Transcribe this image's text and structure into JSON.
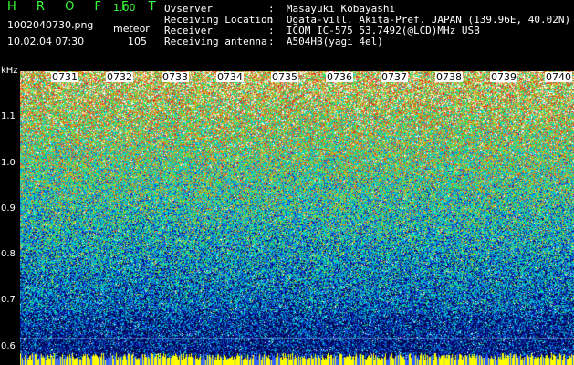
{
  "header": {
    "app_title": "H R O F F T",
    "app_version": "1.00",
    "file_name": "1002040730.png",
    "date_time": "10.02.04 07:30",
    "mode_label": "meteor",
    "mode_count": "105",
    "info": [
      {
        "label": "Ovserver",
        "value": ":  Masayuki Kobayashi"
      },
      {
        "label": "Receiving Location",
        "value": ":  Ogata-vill. Akita-Pref. JAPAN (139.96E, 40.02N)"
      },
      {
        "label": "Receiver",
        "value": ":  ICOM IC-575 53.7492(@LCD)MHz USB"
      },
      {
        "label": "Receiving antenna",
        "value": ":  A504HB(yagi 4el)"
      }
    ]
  },
  "y_axis": {
    "unit": "kHz",
    "ticks": [
      "1.1",
      "1.0",
      "0.9",
      "0.8",
      "0.7",
      "0.6"
    ]
  },
  "x_axis": {
    "ticks": [
      "0731",
      "0732",
      "0733",
      "0734",
      "0735",
      "0736",
      "0737",
      "0738",
      "0739",
      "0740"
    ]
  },
  "colors": {
    "title_green": "#39ff39",
    "background": "#000000",
    "baseline_yellow": "#ffff00"
  }
}
